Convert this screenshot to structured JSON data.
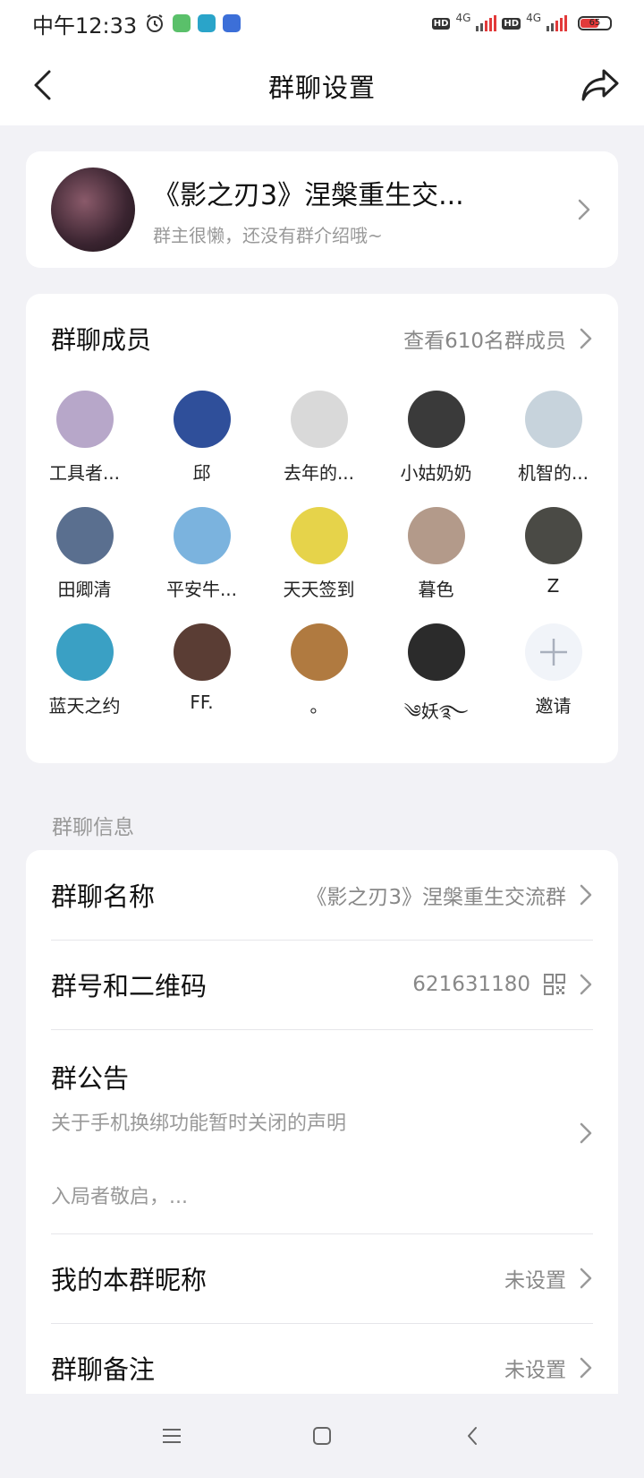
{
  "status_bar": {
    "time": "中午12:33",
    "network_1": "4G",
    "network_2": "4G",
    "hd_label": "HD",
    "battery": "65"
  },
  "nav": {
    "title": "群聊设置"
  },
  "group": {
    "name": "《影之刃3》涅槃重生交...",
    "description": "群主很懒，还没有群介绍哦~"
  },
  "members": {
    "title": "群聊成员",
    "view_all": "查看610名群成员",
    "list": [
      {
        "name": "工具者...",
        "color": "#b7a7c9"
      },
      {
        "name": "邱",
        "color": "#2f4f9a"
      },
      {
        "name": "去年的...",
        "color": "#d9d9d9"
      },
      {
        "name": "小姑奶奶",
        "color": "#3a3a3a"
      },
      {
        "name": "机智的...",
        "color": "#c7d3dc"
      },
      {
        "name": "田卿清",
        "color": "#5a6f8f"
      },
      {
        "name": "平安牛...",
        "color": "#7bb3de"
      },
      {
        "name": "天天签到",
        "color": "#e6d34a"
      },
      {
        "name": "暮色",
        "color": "#b39a8a"
      },
      {
        "name": "Z",
        "color": "#4a4a45"
      },
      {
        "name": "蓝天之约",
        "color": "#3aa0c4"
      },
      {
        "name": "FF.",
        "color": "#5a3d34"
      },
      {
        "name": "。",
        "color": "#b07a40"
      },
      {
        "name": "༄妖࿐",
        "color": "#2b2b2b"
      }
    ],
    "invite_label": "邀请"
  },
  "info_section": {
    "label": "群聊信息",
    "group_name_title": "群聊名称",
    "group_name_value": "《影之刃3》涅槃重生交流群",
    "group_id_title": "群号和二维码",
    "group_id_value": "621631180",
    "notice_title": "群公告",
    "notice_line1": "关于手机换绑功能暂时关闭的声明",
    "notice_line2": "入局者敬启，...",
    "nickname_title": "我的本群昵称",
    "nickname_value": "未设置",
    "remark_title": "群聊备注",
    "remark_value": "未设置"
  }
}
